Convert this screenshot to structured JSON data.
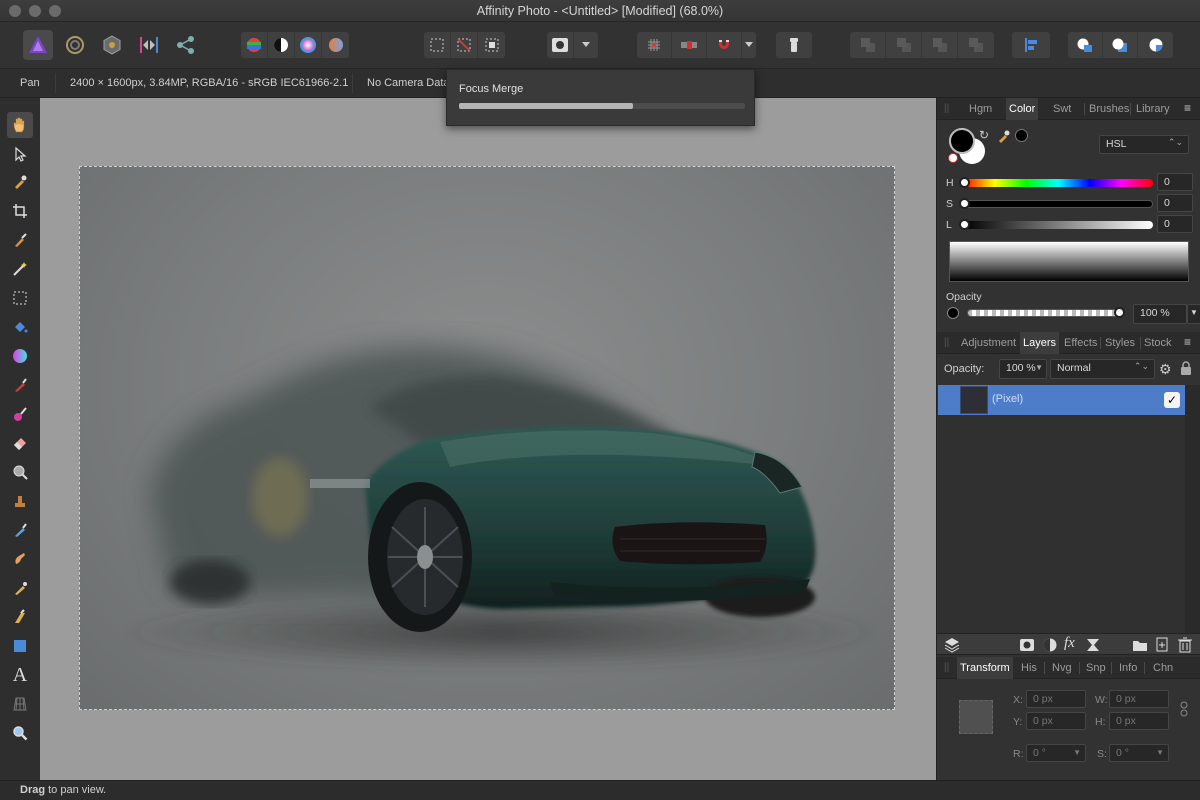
{
  "window": {
    "title": "Affinity Photo - <Untitled> [Modified] (68.0%)"
  },
  "context_bar": {
    "tool_name": "Pan",
    "doc_info": "2400 × 1600px, 3.84MP, RGBA/16 - sRGB IEC61966-2.1",
    "camera": "No Camera Data"
  },
  "popup": {
    "title": "Focus Merge",
    "progress": 0.61
  },
  "status_bar": {
    "bold": "Drag",
    "rest": " to pan view."
  },
  "color_panel": {
    "tabs": [
      "Hgm",
      "Color",
      "Swt",
      "Brushes",
      "Library"
    ],
    "active_tab": "Color",
    "mode": "HSL",
    "h_label": "H",
    "s_label": "S",
    "l_label": "L",
    "h_value": "0",
    "s_value": "0",
    "l_value": "0",
    "opacity_label": "Opacity",
    "opacity_value": "100 %"
  },
  "layers_panel": {
    "tabs": [
      "Adjustment",
      "Layers",
      "Effects",
      "Styles",
      "Stock"
    ],
    "active_tab": "Layers",
    "opacity_label": "Opacity:",
    "opacity_value": "100 %",
    "blend_mode": "Normal",
    "layer_name": "(Pixel)",
    "layer_visible_check": "✓"
  },
  "transform_panel": {
    "tabs": [
      "Transform",
      "His",
      "Nvg",
      "Snp",
      "Info",
      "Chn"
    ],
    "active_tab": "Transform",
    "x_label": "X:",
    "x_value": "0 px",
    "y_label": "Y:",
    "y_value": "0 px",
    "w_label": "W:",
    "w_value": "0 px",
    "h_label": "H:",
    "h_value": "0 px",
    "r_label": "R:",
    "r_value": "0 °",
    "s_label": "S:",
    "s_value": "0 °"
  },
  "icons": {
    "personas": [
      "photo-persona-icon",
      "liquify-persona-icon",
      "develop-persona-icon",
      "tone-mapping-persona-icon",
      "export-persona-icon"
    ],
    "tools": [
      "hand-icon",
      "move-icon",
      "color-picker-icon",
      "crop-icon",
      "selection-brush-icon",
      "magic-wand-icon",
      "marquee-icon",
      "flood-fill-icon",
      "gradient-icon",
      "paint-brush-icon",
      "pixel-brush-icon",
      "erase-brush-icon",
      "dodge-icon",
      "clone-icon",
      "healing-icon",
      "smudge-icon",
      "pen-icon",
      "vector-brush-icon",
      "rectangle-icon",
      "text-icon",
      "mesh-warp-icon",
      "zoom-icon"
    ]
  },
  "colors": {
    "accent": "#4d7cc8",
    "car_body": "#2b4a45"
  }
}
